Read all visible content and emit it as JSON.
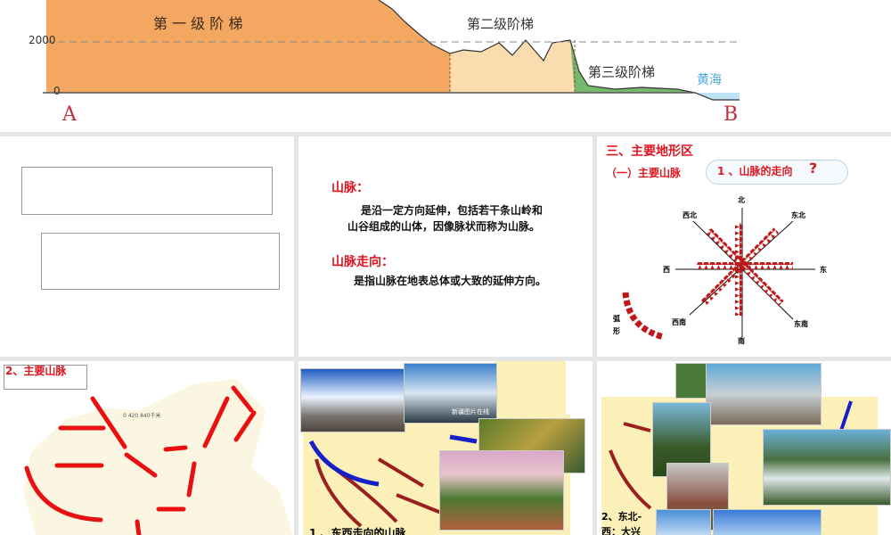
{
  "slide1": {
    "y_2000": "2000",
    "y_0": "0",
    "step1": "第 一 级 阶 梯",
    "step2": "第二级阶梯",
    "step3": "第三级阶梯",
    "sea": "黄海",
    "point_a": "A",
    "point_b": "B"
  },
  "slide3": {
    "term1": "山脉：",
    "def1_line1": "是沿一定方向延伸，包括若干条山岭和",
    "def1_line2": "山谷组成的山体，因像脉状而称为山脉。",
    "term2": "山脉走向：",
    "def2": "是指山脉在地表总体或大致的延伸方向。"
  },
  "slide4": {
    "title": "三、主要地形区",
    "subtitle": "（一）主要山脉",
    "cloud": "1 、山脉的走向",
    "north": "北",
    "south": "南",
    "east": "东",
    "west": "西",
    "ne": "东北",
    "nw": "西北",
    "se": "东南",
    "sw": "西南",
    "arc": "弧形"
  },
  "slide5": {
    "title": "2、主要山脉",
    "scale": "0   420   840千米"
  },
  "slide6": {
    "caption": "1 、东西走向的山脉",
    "watermark": "新疆图片在线"
  },
  "slide7": {
    "caption_line1": "2、东北-",
    "caption_line2": "西：大兴"
  }
}
